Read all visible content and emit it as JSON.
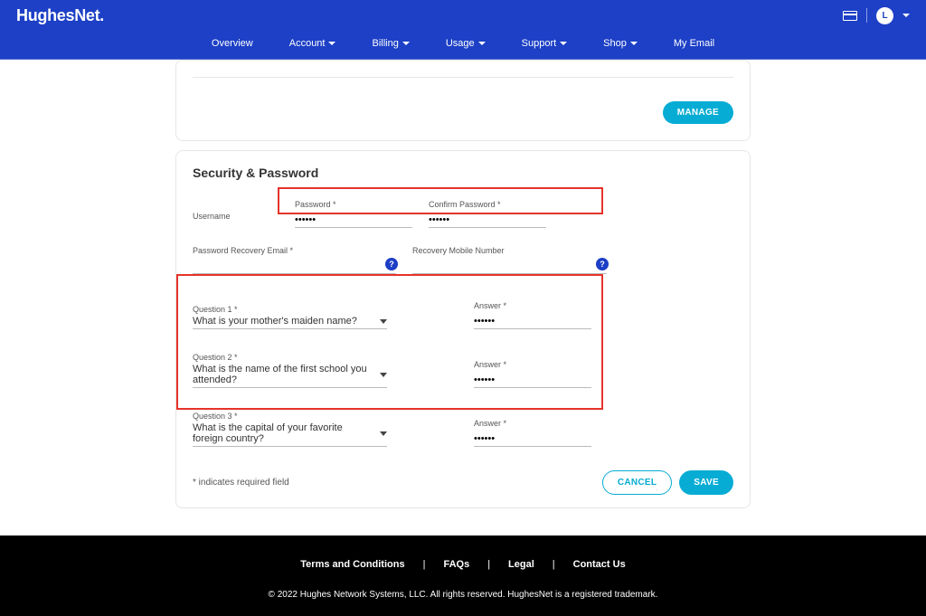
{
  "logo": "HughesNet.",
  "headerAvatarInitial": "L",
  "nav": [
    {
      "label": "Overview",
      "caret": false
    },
    {
      "label": "Account",
      "caret": true
    },
    {
      "label": "Billing",
      "caret": true
    },
    {
      "label": "Usage",
      "caret": true
    },
    {
      "label": "Support",
      "caret": true
    },
    {
      "label": "Shop",
      "caret": true
    },
    {
      "label": "My Email",
      "caret": false
    }
  ],
  "buttons": {
    "manage": "MANAGE",
    "cancel": "CANCEL",
    "save": "SAVE"
  },
  "section": {
    "title": "Security & Password"
  },
  "fields": {
    "username": {
      "label": "Username"
    },
    "password": {
      "label": "Password *",
      "value": "••••••"
    },
    "confirmPassword": {
      "label": "Confirm Password *",
      "value": "••••••"
    },
    "recoveryEmail": {
      "label": "Password Recovery Email *"
    },
    "recoveryMobile": {
      "label": "Recovery Mobile Number"
    }
  },
  "questions": [
    {
      "qlabel": "Question 1 *",
      "qvalue": "What is your mother's maiden name?",
      "alabel": "Answer *",
      "avalue": "••••••"
    },
    {
      "qlabel": "Question 2 *",
      "qvalue": "What is the name of the first school you attended?",
      "alabel": "Answer *",
      "avalue": "••••••"
    },
    {
      "qlabel": "Question 3 *",
      "qvalue": "What is the capital of your favorite foreign country?",
      "alabel": "Answer *",
      "avalue": "••••••"
    }
  ],
  "requiredNote": "* indicates required field",
  "footer": {
    "links": [
      "Terms and Conditions",
      "FAQs",
      "Legal",
      "Contact Us"
    ],
    "copyright": "© 2022 Hughes Network Systems, LLC. All rights reserved. HughesNet is a registered trademark."
  }
}
